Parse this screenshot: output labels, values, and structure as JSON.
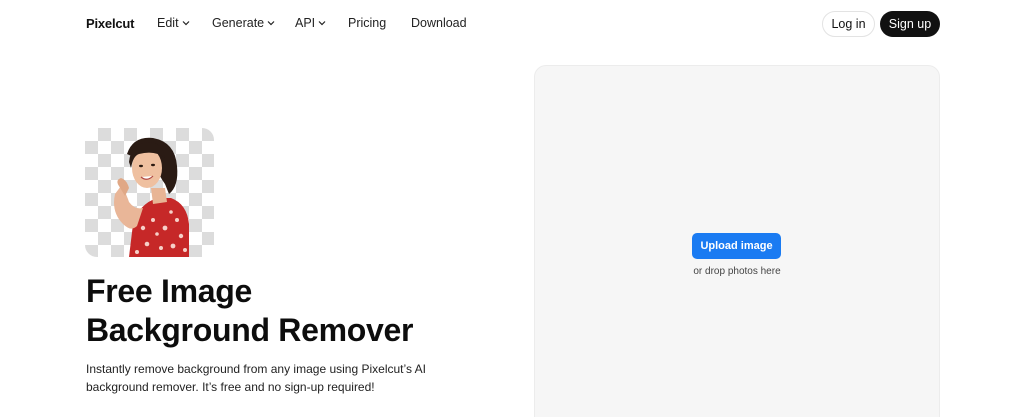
{
  "nav": {
    "logo": "Pixelcut",
    "items": [
      {
        "label": "Edit",
        "has_dropdown": true
      },
      {
        "label": "Generate",
        "has_dropdown": true
      },
      {
        "label": "API",
        "has_dropdown": true
      },
      {
        "label": "Pricing",
        "has_dropdown": false
      },
      {
        "label": "Download",
        "has_dropdown": false
      }
    ],
    "login_label": "Log in",
    "signup_label": "Sign up"
  },
  "hero": {
    "title_line1": "Free Image",
    "title_line2": "Background Remover",
    "subtitle": "Instantly remove background from any image using Pixelcut’s AI background remover. It’s free and no sign-up required!"
  },
  "upload": {
    "button_label": "Upload image",
    "drop_text": "or drop photos here"
  },
  "colors": {
    "accent": "#1a7bf2",
    "signup_bg": "#111111",
    "panel_bg": "#f6f6f6"
  }
}
